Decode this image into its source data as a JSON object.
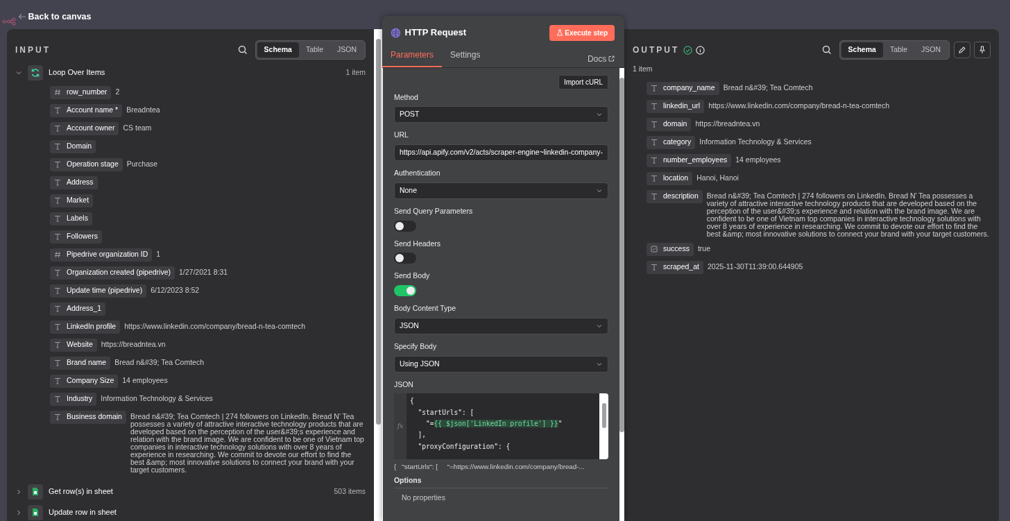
{
  "back_link": "Back to canvas",
  "input": {
    "title": "INPUT",
    "view_tabs": [
      {
        "label": "Schema",
        "selected": true
      },
      {
        "label": "Table",
        "selected": false
      },
      {
        "label": "JSON",
        "selected": false
      }
    ],
    "nodes": [
      {
        "name": "Loop Over Items",
        "kind": "loop",
        "count": "1 item",
        "expanded": true,
        "fields": [
          {
            "kind": "number",
            "key": "row_number",
            "value": "2"
          },
          {
            "kind": "string",
            "key": "Account name *",
            "value": "Breadntea"
          },
          {
            "kind": "string",
            "key": "Account owner",
            "value": "CS team"
          },
          {
            "kind": "string",
            "key": "Domain"
          },
          {
            "kind": "string",
            "key": "Operation stage",
            "value": "Purchase"
          },
          {
            "kind": "string",
            "key": "Address"
          },
          {
            "kind": "string",
            "key": "Market"
          },
          {
            "kind": "string",
            "key": "Labels"
          },
          {
            "kind": "string",
            "key": "Followers"
          },
          {
            "kind": "number",
            "key": "Pipedrive organization ID",
            "value": "1"
          },
          {
            "kind": "string",
            "key": "Organization created (pipedrive)",
            "value": "1/27/2021 8:31"
          },
          {
            "kind": "string",
            "key": "Update time (pipedrive)",
            "value": "6/12/2023 8:52"
          },
          {
            "kind": "string",
            "key": "Address_1"
          },
          {
            "kind": "string",
            "key": "LinkedIn profile",
            "value": "https://www.linkedin.com/company/bread-n-tea-comtech"
          },
          {
            "kind": "string",
            "key": "Website",
            "value": "https://breadntea.vn"
          },
          {
            "kind": "string",
            "key": "Brand name",
            "value": "Bread n&#39; Tea Comtech"
          },
          {
            "kind": "string",
            "key": "Company Size",
            "value": "14 employees"
          },
          {
            "kind": "string",
            "key": "Industry",
            "value": "Information Technology & Services"
          },
          {
            "kind": "string",
            "key": "Business domain",
            "value": "Bread n&#39; Tea Comtech | 274 followers on LinkedIn. Bread N’ Tea possesses a variety of attractive interactive technology products that are developed based on the perception of the user&#39;s experience and relation with the brand image. We are confident to be one of Vietnam top companies in interactive technology solutions with over 8 years of experience in researching. We commit to devote our effort to find the best &amp; most innovative solutions to connect your brand with your target customers."
          }
        ]
      },
      {
        "name": "Get row(s) in sheet",
        "kind": "sheet",
        "count": "503 items",
        "expanded": false
      },
      {
        "name": "Update row in sheet",
        "kind": "sheet",
        "expanded": false
      }
    ]
  },
  "node": {
    "title": "HTTP Request",
    "execute_button": "Execute step",
    "tabs": [
      {
        "label": "Parameters",
        "selected": true
      },
      {
        "label": "Settings",
        "selected": false
      }
    ],
    "docs_link": "Docs",
    "import_button": "Import cURL",
    "params": [
      {
        "kind": "select",
        "label": "Method",
        "value": "POST"
      },
      {
        "kind": "input",
        "label": "URL",
        "value": "https://api.apify.com/v2/acts/scraper-engine~linkedin-company-"
      },
      {
        "kind": "select",
        "label": "Authentication",
        "value": "None"
      },
      {
        "kind": "toggle",
        "label": "Send Query Parameters",
        "on": false
      },
      {
        "kind": "toggle",
        "label": "Send Headers",
        "on": false
      },
      {
        "kind": "toggle",
        "label": "Send Body",
        "on": true
      },
      {
        "kind": "select",
        "label": "Body Content Type",
        "value": "JSON"
      },
      {
        "kind": "select",
        "label": "Specify Body",
        "value": "Using JSON"
      }
    ],
    "json_editor": {
      "label": "JSON",
      "gutter_label": "fx",
      "lines": [
        [
          {
            "text": "{",
            "expression": false
          }
        ],
        [
          {
            "text": "  \"startUrls\": [",
            "expression": false
          }
        ],
        [
          {
            "text": "    \"=",
            "expression": false
          },
          {
            "text": "{{ $json['LinkedIn profile'] }}",
            "expression": true
          },
          {
            "text": "\"",
            "expression": false
          }
        ],
        [
          {
            "text": "  ],",
            "expression": false
          }
        ],
        [
          {
            "text": "  \"proxyConfiguration\": {",
            "expression": false
          }
        ]
      ],
      "preview": "{   \"startUrls\": [     \"=https://www.linkedin.com/company/bread-..."
    },
    "options_title": "Options",
    "options_empty": "No properties"
  },
  "output": {
    "title": "OUTPUT",
    "view_tabs": [
      {
        "label": "Schema",
        "selected": true
      },
      {
        "label": "Table",
        "selected": false
      },
      {
        "label": "JSON",
        "selected": false
      }
    ],
    "count": "1 item",
    "fields": [
      {
        "kind": "string",
        "key": "company_name",
        "value": "Bread n&#39; Tea Comtech"
      },
      {
        "kind": "string",
        "key": "linkedin_url",
        "value": "https://www.linkedin.com/company/bread-n-tea-comtech"
      },
      {
        "kind": "string",
        "key": "domain",
        "value": "https://breadntea.vn"
      },
      {
        "kind": "string",
        "key": "category",
        "value": "Information Technology & Services"
      },
      {
        "kind": "string",
        "key": "number_employees",
        "value": "14 employees"
      },
      {
        "kind": "string",
        "key": "location",
        "value": "Hanoi, Hanoi"
      },
      {
        "kind": "string",
        "key": "description",
        "value": "Bread n&#39; Tea Comtech | 274 followers on LinkedIn. Bread N’ Tea possesses a variety of attractive interactive technology products that are developed based on the perception of the user&#39;s experience and relation with the brand image. We are confident to be one of Vietnam top companies in interactive technology solutions with over 8 years of experience in researching. We commit to devote our effort to find the best &amp; most innovative solutions to connect your brand with your target customers."
      },
      {
        "kind": "boolean",
        "key": "success",
        "value": "true"
      },
      {
        "kind": "string",
        "key": "scraped_at",
        "value": "2025-11-30T11:39:00.644905"
      }
    ]
  }
}
